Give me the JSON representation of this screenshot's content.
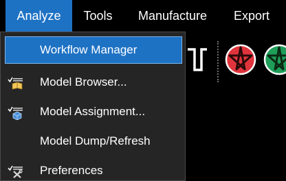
{
  "menubar": {
    "items": [
      {
        "label": "Analyze"
      },
      {
        "label": "Tools"
      },
      {
        "label": "Manufacture"
      },
      {
        "label": "Export"
      }
    ]
  },
  "dropdown": {
    "items": [
      {
        "label": "Workflow Manager",
        "icon": null
      },
      {
        "label": "Model Browser...",
        "icon": "checklist-book-icon"
      },
      {
        "label": "Model Assignment...",
        "icon": "checklist-cube-icon"
      },
      {
        "label": "Model Dump/Refresh",
        "icon": null
      },
      {
        "label": "Preferences",
        "icon": "checklist-tools-icon"
      }
    ]
  },
  "colors": {
    "accent": "#1e72c4",
    "menu_bg": "#252526",
    "bar_bg": "#000000",
    "text": "#ffffff",
    "red_icon": "#e0343c",
    "green_icon": "#1f9e59"
  }
}
